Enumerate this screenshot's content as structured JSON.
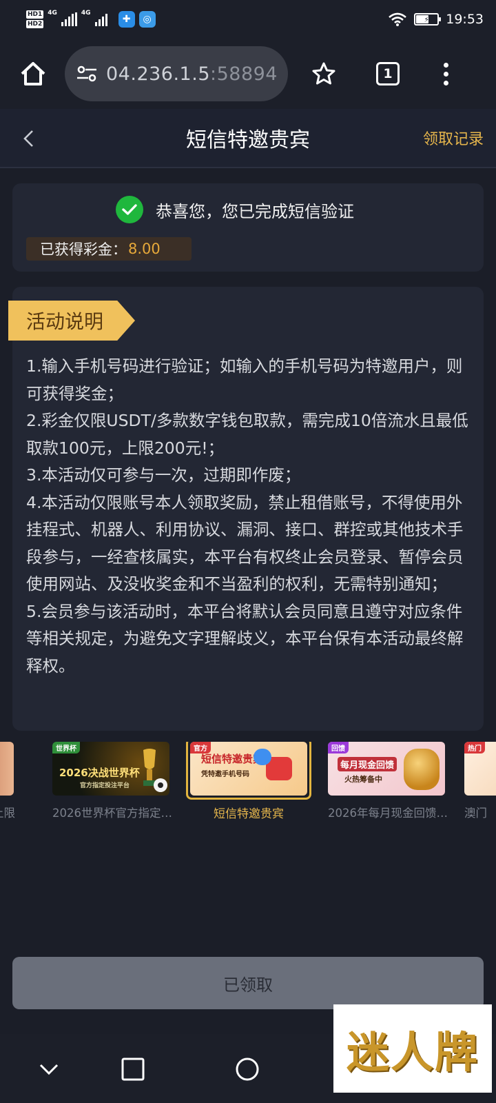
{
  "status_bar": {
    "hd1": "HD1",
    "hd2": "HD2",
    "net1": "4G",
    "net2": "4G",
    "time": "19:53"
  },
  "browser": {
    "url_main": "04.236.1.5",
    "url_port": ":58894",
    "tab_count": "1"
  },
  "header": {
    "title": "短信特邀贵宾",
    "records_link": "领取记录"
  },
  "success": {
    "message": "恭喜您，您已完成短信验证",
    "bonus_label": "已获得彩金：",
    "bonus_value": "8.00"
  },
  "rules": {
    "badge": "活动说明",
    "items": [
      "1.输入手机号码进行验证；如输入的手机号码为特邀用户，则可获得奖金；",
      "2.彩金仅限USDT/多款数字钱包取款，需完成10倍流水且最低取款100元，上限200元!；",
      "3.本活动仅可参与一次，过期即作废；",
      "4.本活动仅限账号本人领取奖励，禁止租借账号，不得使用外挂程式、机器人、利用协议、漏洞、接口、群控或其他技术手段参与，一经查核属实，本平台有权终止会员登录、暂停会员使用网站、及没收奖金和不当盈利的权利，无需特别通知；",
      "5.会员参与该活动时，本平台将默认会员同意且遵守对应条件等相关规定，为避免文字理解歧义，本平台保有本活动最终解释权。"
    ]
  },
  "carousel": {
    "slides": [
      {
        "caption": "上限",
        "thumb_text": "",
        "active": false
      },
      {
        "caption": "2026世界杯官方指定…",
        "thumb_text": "2026决战世界杯",
        "thumb_sub": "官方指定投注平台",
        "thumb_tag": "世界杯",
        "active": false
      },
      {
        "caption": "短信特邀贵宾",
        "thumb_text": "短信特邀贵宾",
        "thumb_sub": "凭特邀手机号码",
        "thumb_tag": "官方",
        "active": true
      },
      {
        "caption": "2026年每月现金回馈…",
        "thumb_text": "每月现金回馈",
        "thumb_sub": "火热筹备中",
        "thumb_tag": "回馈",
        "active": false
      },
      {
        "caption": "澳门",
        "thumb_text": "",
        "thumb_tag": "热门",
        "active": false
      }
    ]
  },
  "claim_button": "已领取",
  "watermark": "迷人牌",
  "colors": {
    "accent_gold": "#e6b64c",
    "success_green": "#1fb73d",
    "bonus_orange": "#e7a93a",
    "background": "#1b1e28"
  }
}
